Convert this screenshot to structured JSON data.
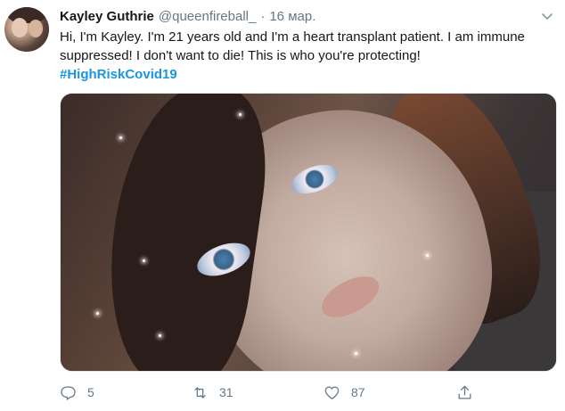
{
  "author": {
    "name": "Kayley Guthrie",
    "handle": "@queenfireball_",
    "separator": "·",
    "date": "16 мар."
  },
  "tweet": {
    "text": "Hi, I'm Kayley. I'm 21 years old and I'm a heart transplant patient. I am immune suppressed! I don't want to die! This is who you're protecting!",
    "hashtag": "#HighRiskCovid19"
  },
  "actions": {
    "reply_count": "5",
    "retweet_count": "31",
    "like_count": "87"
  },
  "icons": {
    "reply": "reply-icon",
    "retweet": "retweet-icon",
    "like": "heart-icon",
    "share": "share-icon",
    "more": "chevron-down-icon"
  },
  "colors": {
    "link": "#1b95e0",
    "secondary": "#657786",
    "primary": "#14171a"
  }
}
